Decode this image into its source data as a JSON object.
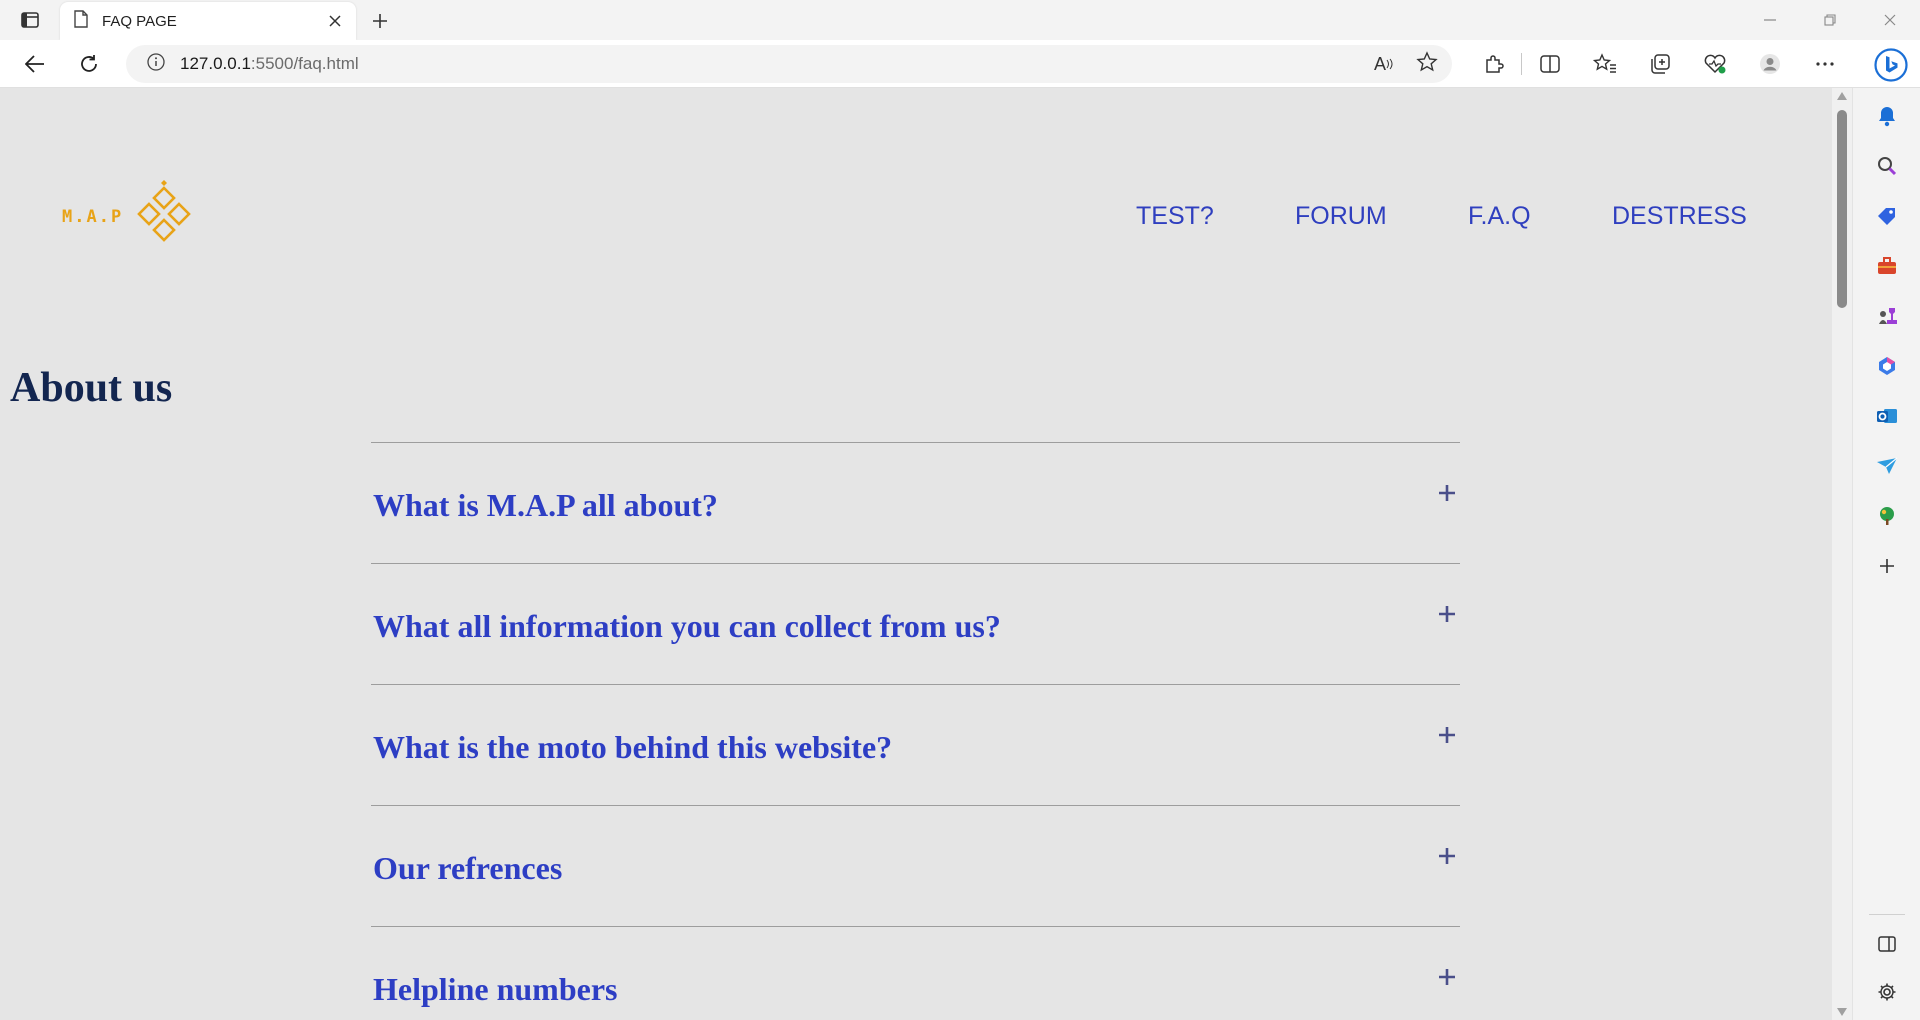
{
  "browser": {
    "tab_title": "FAQ PAGE",
    "url_host": "127.0.0.1",
    "url_path": ":5500/faq.html",
    "read_aloud_label": "A"
  },
  "site": {
    "logo_text": "M.A.P",
    "brand_color": "#e8a317",
    "nav": [
      {
        "label": "TEST?"
      },
      {
        "label": "FORUM"
      },
      {
        "label": "F.A.Q"
      },
      {
        "label": "DESTRESS"
      }
    ],
    "section_title": "About us",
    "faq": [
      {
        "question": "What is M.A.P all about?"
      },
      {
        "question": "What all information you can collect from us?"
      },
      {
        "question": "What is the moto behind this website?"
      },
      {
        "question": "Our refrences"
      },
      {
        "question": "Helpline numbers"
      }
    ],
    "accent_color": "#2d3ec4",
    "heading_color": "#132650"
  }
}
